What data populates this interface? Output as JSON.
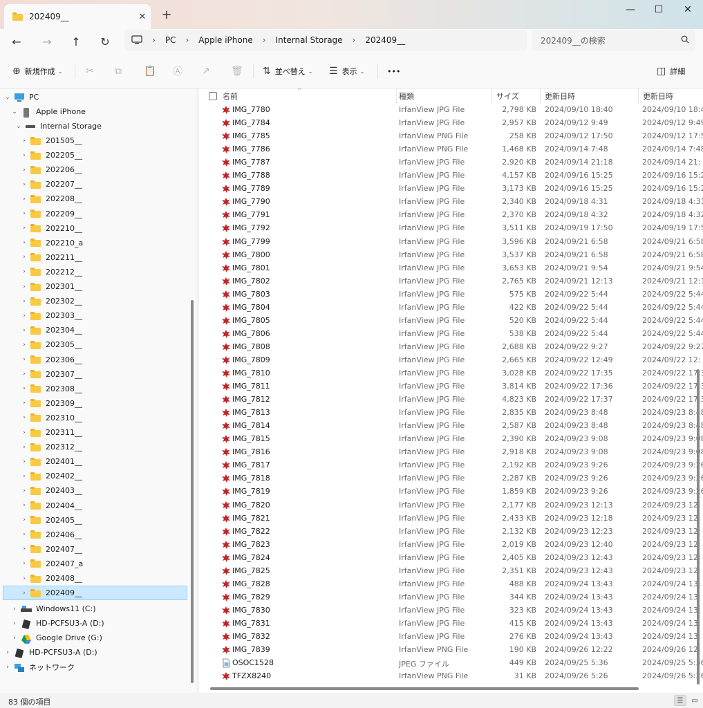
{
  "tab": {
    "title": "202409__",
    "close": "✕",
    "new_tab": "+"
  },
  "window": {
    "minimize": "—",
    "maximize": "☐",
    "close": "✕"
  },
  "address": {
    "back": "←",
    "forward": "→",
    "up": "↑",
    "refresh": "↻",
    "crumbs": [
      "PC",
      "Apple iPhone",
      "Internal Storage",
      "202409__"
    ],
    "search_placeholder": "202409__の検索"
  },
  "commands": {
    "new": "新規作成",
    "sort": "並べ替え",
    "view": "表示",
    "more": "•••",
    "details": "詳細"
  },
  "nav": {
    "pc": "PC",
    "iphone": "Apple iPhone",
    "storage": "Internal Storage",
    "folders": [
      "201505__",
      "202205__",
      "202206__",
      "202207__",
      "202208__",
      "202209__",
      "202210__",
      "202210_a",
      "202211__",
      "202212__",
      "202301__",
      "202302__",
      "202303__",
      "202304__",
      "202305__",
      "202306__",
      "202307__",
      "202308__",
      "202309__",
      "202310__",
      "202311__",
      "202312__",
      "202401__",
      "202402__",
      "202403__",
      "202404__",
      "202405__",
      "202406__",
      "202407__",
      "202407_a",
      "202408__",
      "202409__"
    ],
    "drives": [
      "Windows11 (C:)",
      "HD-PCFSU3-A (D:)",
      "Google Drive (G:)"
    ],
    "root_drive": "HD-PCFSU3-A (D:)",
    "network": "ネットワーク"
  },
  "columns": {
    "name": "名前",
    "type": "種類",
    "size": "サイズ",
    "modified": "更新日時",
    "modified2": "更新日時"
  },
  "files": [
    {
      "name": "IMG_7780",
      "type": "IrfanView JPG File",
      "size": "2,798 KB",
      "date": "2024/09/10 18:40",
      "date2": "2024/09/10 18:4"
    },
    {
      "name": "IMG_7784",
      "type": "IrfanView JPG File",
      "size": "2,957 KB",
      "date": "2024/09/12 9:49",
      "date2": "2024/09/12 9:49"
    },
    {
      "name": "IMG_7785",
      "type": "IrfanView PNG File",
      "size": "258 KB",
      "date": "2024/09/12 17:50",
      "date2": "2024/09/12 17:5"
    },
    {
      "name": "IMG_7786",
      "type": "IrfanView PNG File",
      "size": "1,468 KB",
      "date": "2024/09/14 7:48",
      "date2": "2024/09/14 7:48"
    },
    {
      "name": "IMG_7787",
      "type": "IrfanView JPG File",
      "size": "2,920 KB",
      "date": "2024/09/14 21:18",
      "date2": "2024/09/14 21:"
    },
    {
      "name": "IMG_7788",
      "type": "IrfanView JPG File",
      "size": "4,157 KB",
      "date": "2024/09/16 15:25",
      "date2": "2024/09/16 15:2"
    },
    {
      "name": "IMG_7789",
      "type": "IrfanView JPG File",
      "size": "3,173 KB",
      "date": "2024/09/16 15:25",
      "date2": "2024/09/16 15:2"
    },
    {
      "name": "IMG_7790",
      "type": "IrfanView JPG File",
      "size": "2,340 KB",
      "date": "2024/09/18 4:31",
      "date2": "2024/09/18 4:31"
    },
    {
      "name": "IMG_7791",
      "type": "IrfanView JPG File",
      "size": "2,370 KB",
      "date": "2024/09/18 4:32",
      "date2": "2024/09/18 4:32"
    },
    {
      "name": "IMG_7792",
      "type": "IrfanView JPG File",
      "size": "3,511 KB",
      "date": "2024/09/19 17:50",
      "date2": "2024/09/19 17:5"
    },
    {
      "name": "IMG_7799",
      "type": "IrfanView JPG File",
      "size": "3,596 KB",
      "date": "2024/09/21 6:58",
      "date2": "2024/09/21 6:58"
    },
    {
      "name": "IMG_7800",
      "type": "IrfanView JPG File",
      "size": "3,537 KB",
      "date": "2024/09/21 6:58",
      "date2": "2024/09/21 6:58"
    },
    {
      "name": "IMG_7801",
      "type": "IrfanView JPG File",
      "size": "3,653 KB",
      "date": "2024/09/21 9:54",
      "date2": "2024/09/21 9:54"
    },
    {
      "name": "IMG_7802",
      "type": "IrfanView JPG File",
      "size": "2,765 KB",
      "date": "2024/09/21 12:13",
      "date2": "2024/09/21 12:1"
    },
    {
      "name": "IMG_7803",
      "type": "IrfanView JPG File",
      "size": "575 KB",
      "date": "2024/09/22 5:44",
      "date2": "2024/09/22 5:44"
    },
    {
      "name": "IMG_7804",
      "type": "IrfanView JPG File",
      "size": "422 KB",
      "date": "2024/09/22 5:44",
      "date2": "2024/09/22 5:44"
    },
    {
      "name": "IMG_7805",
      "type": "IrfanView JPG File",
      "size": "520 KB",
      "date": "2024/09/22 5:44",
      "date2": "2024/09/22 5:44"
    },
    {
      "name": "IMG_7806",
      "type": "IrfanView JPG File",
      "size": "538 KB",
      "date": "2024/09/22 5:44",
      "date2": "2024/09/22 5:44"
    },
    {
      "name": "IMG_7808",
      "type": "IrfanView JPG File",
      "size": "2,688 KB",
      "date": "2024/09/22 9:27",
      "date2": "2024/09/22 9:27"
    },
    {
      "name": "IMG_7809",
      "type": "IrfanView JPG File",
      "size": "2,665 KB",
      "date": "2024/09/22 12:49",
      "date2": "2024/09/22 12:"
    },
    {
      "name": "IMG_7810",
      "type": "IrfanView JPG File",
      "size": "3,028 KB",
      "date": "2024/09/22 17:35",
      "date2": "2024/09/22 17:3"
    },
    {
      "name": "IMG_7811",
      "type": "IrfanView JPG File",
      "size": "3,814 KB",
      "date": "2024/09/22 17:36",
      "date2": "2024/09/22 17:3"
    },
    {
      "name": "IMG_7812",
      "type": "IrfanView JPG File",
      "size": "4,823 KB",
      "date": "2024/09/22 17:37",
      "date2": "2024/09/22 17:3"
    },
    {
      "name": "IMG_7813",
      "type": "IrfanView JPG File",
      "size": "2,835 KB",
      "date": "2024/09/23 8:48",
      "date2": "2024/09/23 8:48"
    },
    {
      "name": "IMG_7814",
      "type": "IrfanView JPG File",
      "size": "2,587 KB",
      "date": "2024/09/23 8:48",
      "date2": "2024/09/23 8:48"
    },
    {
      "name": "IMG_7815",
      "type": "IrfanView JPG File",
      "size": "2,390 KB",
      "date": "2024/09/23 9:08",
      "date2": "2024/09/23 9:08"
    },
    {
      "name": "IMG_7816",
      "type": "IrfanView JPG File",
      "size": "2,918 KB",
      "date": "2024/09/23 9:08",
      "date2": "2024/09/23 9:08"
    },
    {
      "name": "IMG_7817",
      "type": "IrfanView JPG File",
      "size": "2,192 KB",
      "date": "2024/09/23 9:26",
      "date2": "2024/09/23 9:26"
    },
    {
      "name": "IMG_7818",
      "type": "IrfanView JPG File",
      "size": "2,287 KB",
      "date": "2024/09/23 9:26",
      "date2": "2024/09/23 9:26"
    },
    {
      "name": "IMG_7819",
      "type": "IrfanView JPG File",
      "size": "1,859 KB",
      "date": "2024/09/23 9:26",
      "date2": "2024/09/23 9:26"
    },
    {
      "name": "IMG_7820",
      "type": "IrfanView JPG File",
      "size": "2,177 KB",
      "date": "2024/09/23 12:13",
      "date2": "2024/09/23 12:"
    },
    {
      "name": "IMG_7821",
      "type": "IrfanView JPG File",
      "size": "2,433 KB",
      "date": "2024/09/23 12:18",
      "date2": "2024/09/23 12:"
    },
    {
      "name": "IMG_7822",
      "type": "IrfanView JPG File",
      "size": "2,132 KB",
      "date": "2024/09/23 12:23",
      "date2": "2024/09/23 12:"
    },
    {
      "name": "IMG_7823",
      "type": "IrfanView JPG File",
      "size": "2,019 KB",
      "date": "2024/09/23 12:40",
      "date2": "2024/09/23 12:"
    },
    {
      "name": "IMG_7824",
      "type": "IrfanView JPG File",
      "size": "2,405 KB",
      "date": "2024/09/23 12:43",
      "date2": "2024/09/23 12:"
    },
    {
      "name": "IMG_7825",
      "type": "IrfanView JPG File",
      "size": "2,351 KB",
      "date": "2024/09/23 12:43",
      "date2": "2024/09/23 12:"
    },
    {
      "name": "IMG_7828",
      "type": "IrfanView JPG File",
      "size": "488 KB",
      "date": "2024/09/24 13:43",
      "date2": "2024/09/24 13:"
    },
    {
      "name": "IMG_7829",
      "type": "IrfanView JPG File",
      "size": "344 KB",
      "date": "2024/09/24 13:43",
      "date2": "2024/09/24 13:"
    },
    {
      "name": "IMG_7830",
      "type": "IrfanView JPG File",
      "size": "323 KB",
      "date": "2024/09/24 13:43",
      "date2": "2024/09/24 13:"
    },
    {
      "name": "IMG_7831",
      "type": "IrfanView JPG File",
      "size": "415 KB",
      "date": "2024/09/24 13:43",
      "date2": "2024/09/24 13:"
    },
    {
      "name": "IMG_7832",
      "type": "IrfanView JPG File",
      "size": "276 KB",
      "date": "2024/09/24 13:43",
      "date2": "2024/09/24 13:"
    },
    {
      "name": "IMG_7839",
      "type": "IrfanView PNG File",
      "size": "190 KB",
      "date": "2024/09/26 12:22",
      "date2": "2024/09/26 12:"
    },
    {
      "name": "OSOC1528",
      "type": "JPEG ファイル",
      "size": "449 KB",
      "date": "2024/09/25 5:36",
      "date2": "2024/09/25 5:36"
    },
    {
      "name": "TFZX8240",
      "type": "IrfanView PNG File",
      "size": "31 KB",
      "date": "2024/09/26 5:26",
      "date2": "2024/09/26 5:26"
    }
  ],
  "status": {
    "count": "83 個の項目"
  },
  "colors": {
    "folder": "#f8c943",
    "irfan": "#c0282b",
    "selected": "#cce8ff",
    "accent": "#0067c0"
  }
}
